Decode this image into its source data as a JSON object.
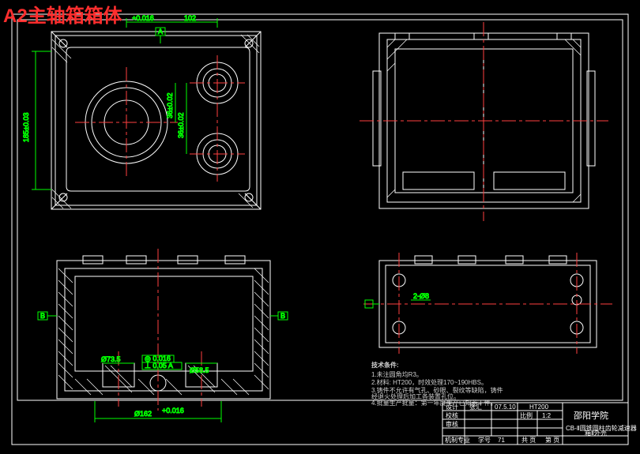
{
  "title_overlay": "A2主轴箱箱体",
  "dimensions": {
    "top_tol": "+0.016",
    "top_val": "102",
    "left_vert": "185±0.03",
    "mid_vert1": "36±0.02",
    "mid_vert2": "36±0.02",
    "datum_a_top": "A",
    "diam1": "Ø73.5",
    "diam2": "Ø58.5",
    "bottom_main": "Ø162",
    "bottom_tol": "+0.016",
    "gtol1": "◎ 0.016",
    "gtol2": "⊥ 0.05 A",
    "datum_b_left": "B",
    "datum_b_right": "B",
    "side_small": "2-Ø8"
  },
  "notes_header": "技术条件:",
  "notes": [
    "1.未注圆角均R3。",
    "2.材料: HT200，时效处理170~190HBS。",
    "3.铸件不允许有气孔、砂眼、裂纹等缺陷，铸件",
    "经退火处理后加工各装置孔位。",
    "4.批量生产批量：第一年度生产已知若干件。"
  ],
  "titleblock": {
    "r1c1": "设计",
    "r1c2": "张汇",
    "r1c3": "07.5.10",
    "r2c1": "校核",
    "r2c2": "",
    "r2c3": "",
    "r3c1": "审核",
    "r3c2": "",
    "r3c3": "",
    "material": "HT200",
    "scale_lbl": "比例",
    "scale_val": "1:2",
    "school": "邵阳学院",
    "desc": "CB-Ⅱ圆锥圆柱齿轮减速器",
    "desc2": "箱Ⅱ外壳",
    "class_lbl": "机制专业",
    "num_lbl": "学号",
    "num_val": "71",
    "sheet_lbl": "共 页",
    "sheet2_lbl": "第 页"
  }
}
